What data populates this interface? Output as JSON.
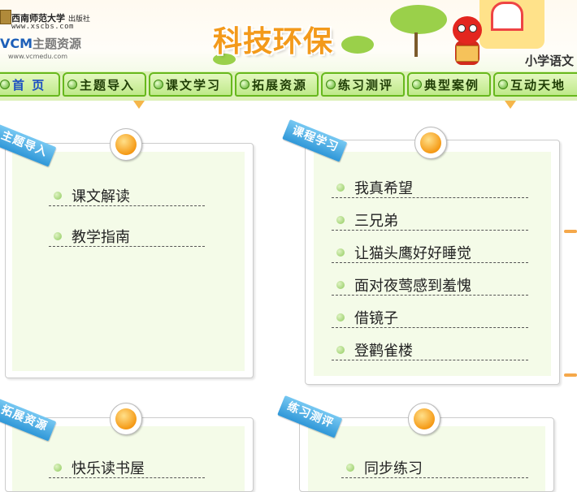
{
  "header": {
    "publisher_name": "西南师范大学",
    "publisher_suffix": "出版社",
    "publisher_url": "www.xscbs.com",
    "brand_prefix": "VCM",
    "brand_name": "主题资源",
    "brand_url": "www.vcmedu.com",
    "site_title": "科技环保",
    "grade_label": "小学语文"
  },
  "nav": {
    "items": [
      {
        "label": "首 页"
      },
      {
        "label": "主题导入"
      },
      {
        "label": "课文学习"
      },
      {
        "label": "拓展资源"
      },
      {
        "label": "练习测评"
      },
      {
        "label": "典型案例"
      },
      {
        "label": "互动天地"
      }
    ]
  },
  "panels": {
    "intro": {
      "ribbon": "主题导入",
      "items": [
        "课文解读",
        "教学指南"
      ]
    },
    "course": {
      "ribbon": "课程学习",
      "items": [
        "我真希望",
        "三兄弟",
        "让猫头鹰好好睡觉",
        "面对夜莺感到羞愧",
        "借镜子",
        "登鹳雀楼"
      ]
    },
    "extend": {
      "ribbon": "拓展资源",
      "items": [
        "快乐读书屋"
      ]
    },
    "practice": {
      "ribbon": "练习测评",
      "items": [
        "同步练习"
      ]
    }
  },
  "colors": {
    "nav_border": "#67b81d",
    "nav_fill": "#bfe98a",
    "ribbon": "#2f97d8",
    "title": "#f39a1b",
    "panel_fill": "#f4fbe8"
  }
}
